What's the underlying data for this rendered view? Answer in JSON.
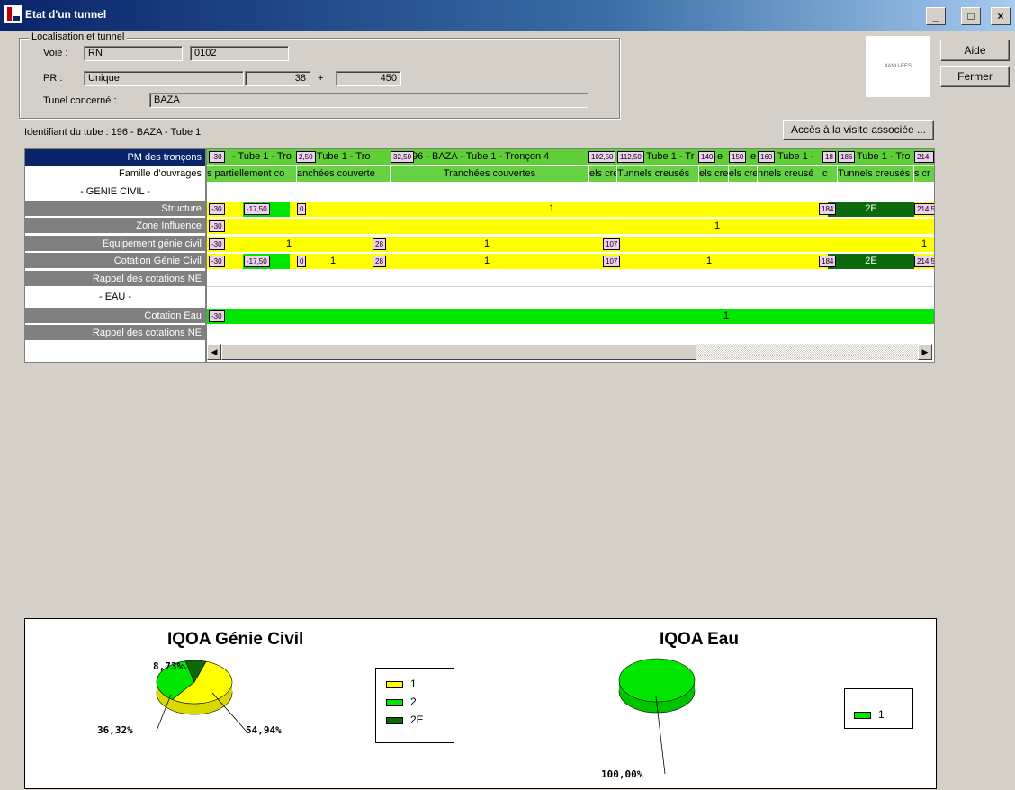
{
  "window": {
    "title": "Etat d'un tunnel",
    "min": "_",
    "max": "□",
    "close": "×"
  },
  "localisation": {
    "legend": "Localisation et tunnel",
    "voie_label": "Voie :",
    "voie_type": "RN",
    "voie_num": "0102",
    "pr_label": "PR :",
    "pr_type": "Unique",
    "pr_value": "38",
    "pr_plus": "+",
    "pr_offset": "450",
    "tunnel_label": "Tunel concerné :",
    "tunnel_value": "BAZA"
  },
  "logo_text": "4ANU-EES",
  "buttons": {
    "aide": "Aide",
    "fermer": "Fermer",
    "visite": "Accès à la visite associée ..."
  },
  "tube_id": "Identifiant du tube : 196 - BAZA - Tube 1",
  "rows": {
    "pm": "PM des tronçons",
    "famille": "Famille d'ouvrages",
    "genie": "- GENIE CIVIL -",
    "structure": "Structure",
    "zone": "Zone Influence",
    "equipement": "Equipement génie civil",
    "cotation_gc": "Cotation Génie Civil",
    "rappel1": "Rappel des cotations NE",
    "eau": "- EAU -",
    "cotation_eau": "Cotation Eau",
    "rappel2": "Rappel des cotations NE"
  },
  "pm_cells": [
    "- Tube 1 - Tro",
    "Tube 1 - Tro",
    "96 - BAZA - Tube 1 - Tronçon 4",
    "Tube 1 - Tr",
    "e",
    "e",
    "Tube 1 - ",
    "Tube 1 - Tro"
  ],
  "pm_tags": [
    "-30",
    "2,50",
    "32,50",
    "102,50",
    "112,50",
    "140",
    "150",
    "160",
    "18",
    "186",
    "214,"
  ],
  "famille_cells": [
    "s partiellement co",
    "anchées couverte",
    "Tranchées couvertes",
    "els cre",
    "Tunnels creusés",
    "els cre",
    "els cre",
    "nnels creusé",
    "c",
    "Tunnels creusés",
    "s cr"
  ],
  "structure": {
    "tags": [
      "-30",
      "-17,50",
      "0",
      "184",
      "214,5"
    ],
    "v1": "1",
    "v2": "2E"
  },
  "zone": {
    "tags": [
      "-30"
    ],
    "v1": "1"
  },
  "equip": {
    "tags": [
      "-30",
      "28",
      "107"
    ],
    "v1": "1",
    "v2": "1",
    "v3": "1"
  },
  "cot_gc": {
    "tags": [
      "-30",
      "-17,50",
      "0",
      "28",
      "107",
      "184",
      "214,5"
    ],
    "v1": "1",
    "v2": "1",
    "v3": "1",
    "v4": "2E"
  },
  "cot_eau": {
    "tags": [
      "-30"
    ],
    "v1": "1"
  },
  "scroll": {
    "left": "◀",
    "right": "▶"
  },
  "chart_data": [
    {
      "type": "pie",
      "title": "IQOA Génie Civil",
      "categories": [
        "1",
        "2",
        "2E"
      ],
      "values": [
        54.94,
        36.32,
        8.73
      ],
      "labels": [
        "54,94%",
        "36,32%",
        "8,73%"
      ],
      "colors": [
        "#ffff00",
        "#00e600",
        "#0c6a0c"
      ],
      "legend": "right"
    },
    {
      "type": "pie",
      "title": "IQOA Eau",
      "categories": [
        "1"
      ],
      "values": [
        100.0
      ],
      "labels": [
        "100,00%"
      ],
      "colors": [
        "#00e600"
      ],
      "legend": "right"
    }
  ]
}
